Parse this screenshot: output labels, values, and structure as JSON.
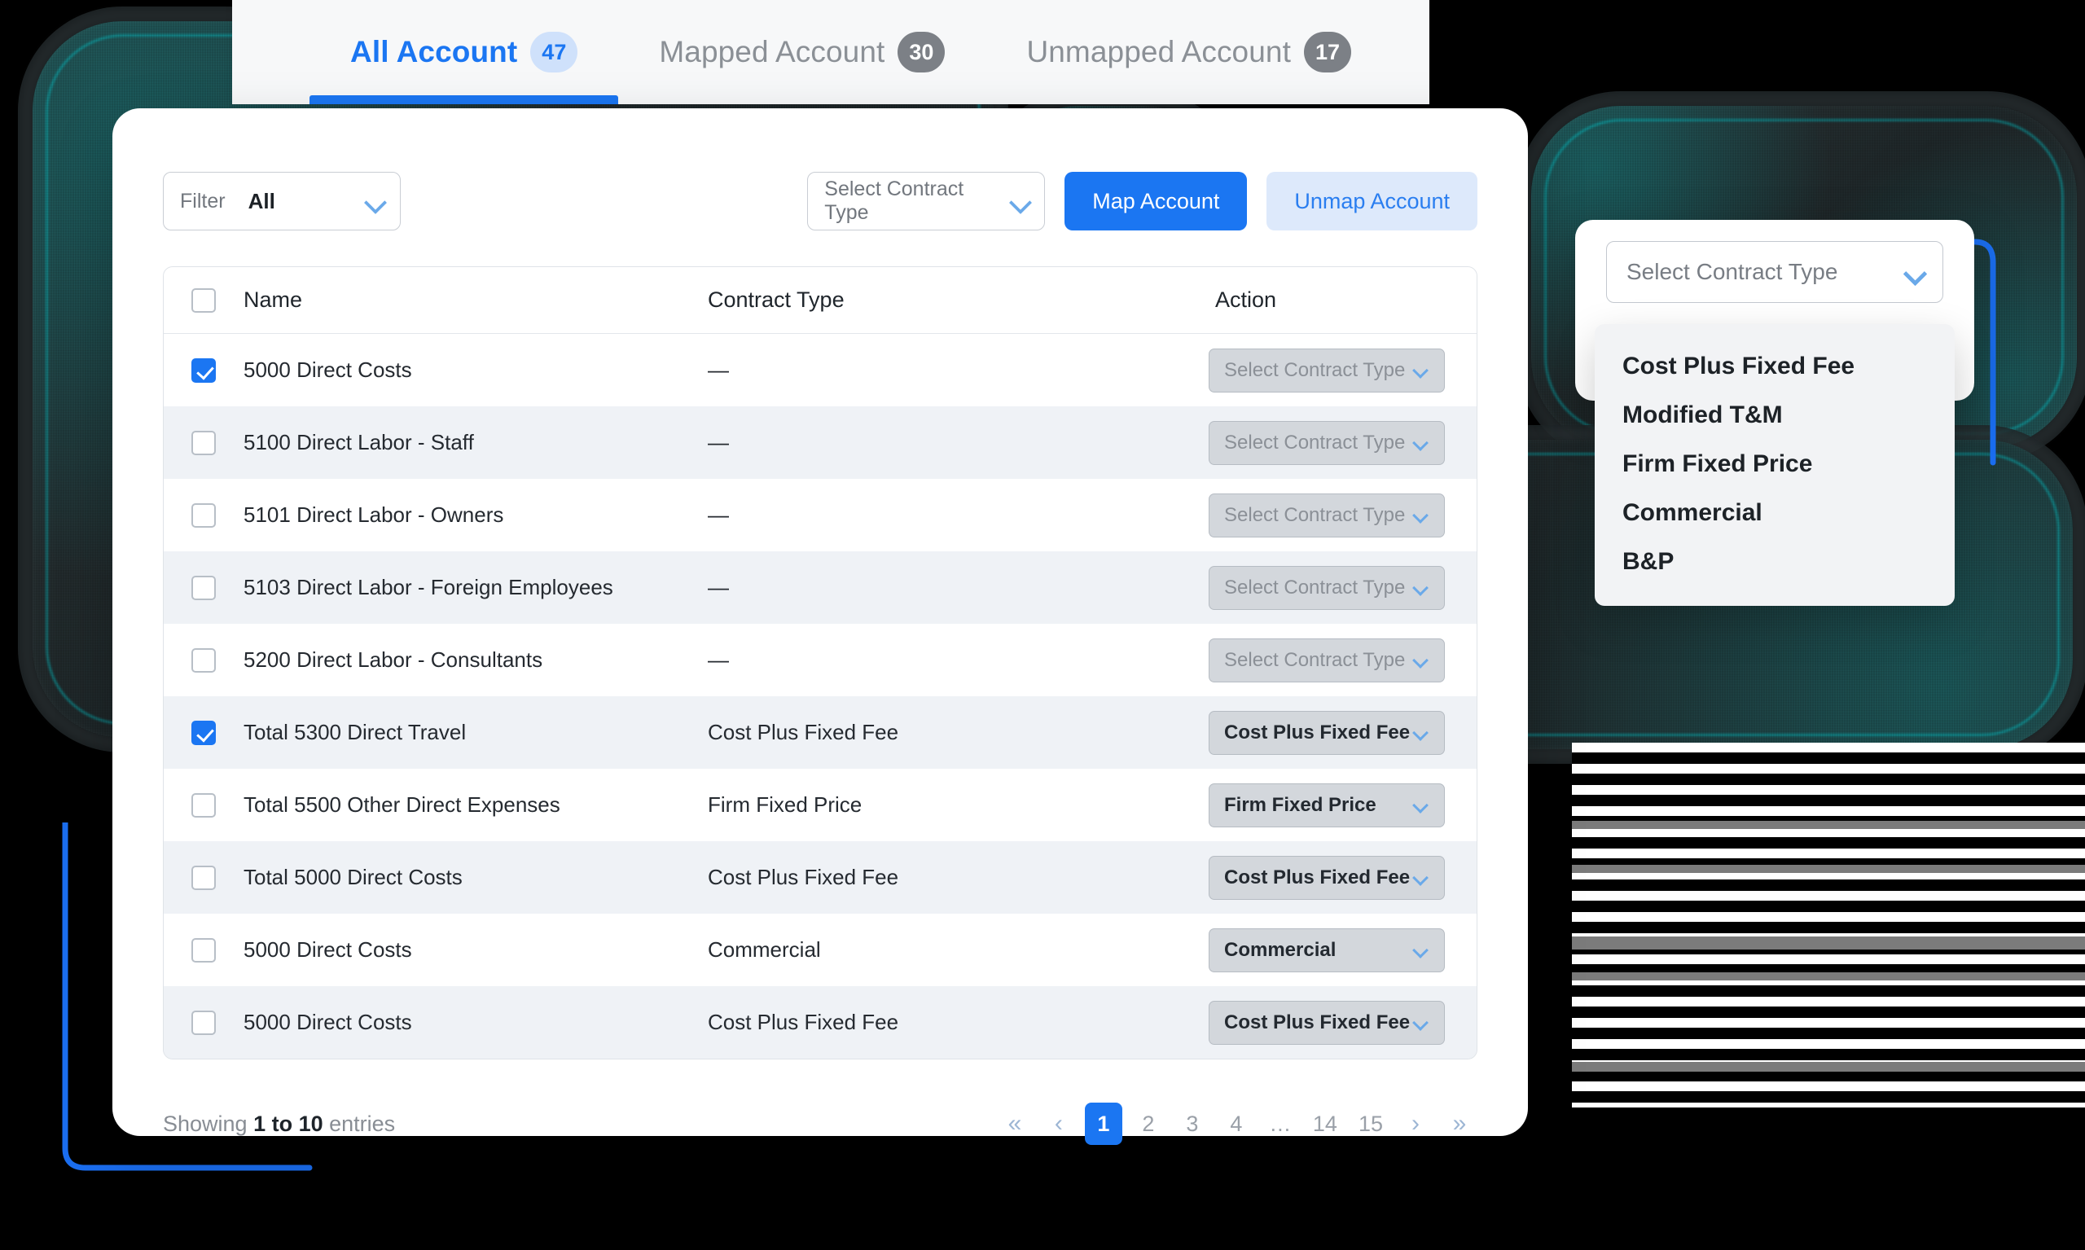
{
  "tabs": [
    {
      "label": "All Account",
      "badge": "47",
      "active": true
    },
    {
      "label": "Mapped Account",
      "badge": "30",
      "active": false
    },
    {
      "label": "Unmapped Account",
      "badge": "17",
      "active": false
    }
  ],
  "toolbar": {
    "filter_label": "Filter",
    "filter_value": "All",
    "contract_select_placeholder": "Select Contract Type",
    "map_account_label": "Map Account",
    "unmap_account_label": "Unmap Account"
  },
  "table": {
    "headers": {
      "name": "Name",
      "contract_type": "Contract Type",
      "action": "Action"
    },
    "empty_value": "—",
    "action_placeholder": "Select Contract Type",
    "rows": [
      {
        "checked": true,
        "name": "5000 Direct Costs",
        "contract_type": "—",
        "action_value": "Select Contract Type",
        "action_filled": false
      },
      {
        "checked": false,
        "name": "5100 Direct Labor - Staff",
        "contract_type": "—",
        "action_value": "Select Contract Type",
        "action_filled": false
      },
      {
        "checked": false,
        "name": "5101 Direct Labor - Owners",
        "contract_type": "—",
        "action_value": "Select Contract Type",
        "action_filled": false
      },
      {
        "checked": false,
        "name": "5103 Direct Labor - Foreign Employees",
        "contract_type": "—",
        "action_value": "Select Contract Type",
        "action_filled": false
      },
      {
        "checked": false,
        "name": "5200 Direct Labor - Consultants",
        "contract_type": "—",
        "action_value": "Select Contract Type",
        "action_filled": false
      },
      {
        "checked": true,
        "name": "Total 5300 Direct Travel",
        "contract_type": "Cost Plus Fixed Fee",
        "action_value": "Cost Plus Fixed Fee",
        "action_filled": true
      },
      {
        "checked": false,
        "name": "Total 5500 Other Direct Expenses",
        "contract_type": "Firm Fixed Price",
        "action_value": "Firm Fixed Price",
        "action_filled": true
      },
      {
        "checked": false,
        "name": "Total 5000 Direct Costs",
        "contract_type": "Cost Plus Fixed Fee",
        "action_value": "Cost Plus Fixed Fee",
        "action_filled": true
      },
      {
        "checked": false,
        "name": "5000 Direct Costs",
        "contract_type": "Commercial",
        "action_value": "Commercial",
        "action_filled": true
      },
      {
        "checked": false,
        "name": "5000 Direct Costs",
        "contract_type": "Cost Plus Fixed Fee",
        "action_value": "Cost Plus Fixed Fee",
        "action_filled": true
      }
    ]
  },
  "footer": {
    "showing_prefix": "Showing ",
    "showing_range": "1 to 10",
    "showing_suffix": " entries",
    "pager": {
      "first": "«",
      "prev": "‹",
      "pages": [
        "1",
        "2",
        "3",
        "4",
        "…",
        "14",
        "15"
      ],
      "active_page": "1",
      "next": "›",
      "last": "»"
    }
  },
  "dropdown_panel": {
    "trigger_placeholder": "Select Contract Type",
    "options": [
      "Cost Plus Fixed Fee",
      "Modified T&M",
      "Firm Fixed Price",
      "Commercial",
      "B&P"
    ]
  },
  "colors": {
    "accent_blue": "#1b76f2",
    "soft_blue": "#dde9fb",
    "teal_glow": "#00c8cd",
    "row_alt": "#eff2f6",
    "muted_text": "#8b9096"
  }
}
